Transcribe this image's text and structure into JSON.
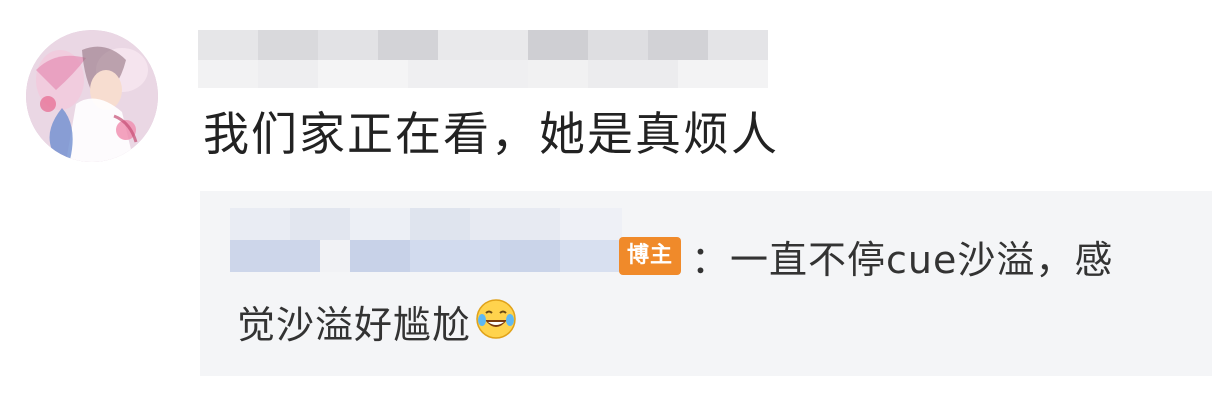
{
  "comment": {
    "text": "我们家正在看，她是真烦人",
    "avatar_icon": "user-avatar"
  },
  "reply": {
    "badge": "博主",
    "line1": "：一直不停cue沙溢，感",
    "line2": "觉沙溢好尴尬",
    "emoji_icon": "laugh-cry-emoji-icon"
  },
  "colors": {
    "badge_bg": "#f08a2a",
    "reply_bg": "#f4f5f7",
    "text": "#222222"
  }
}
